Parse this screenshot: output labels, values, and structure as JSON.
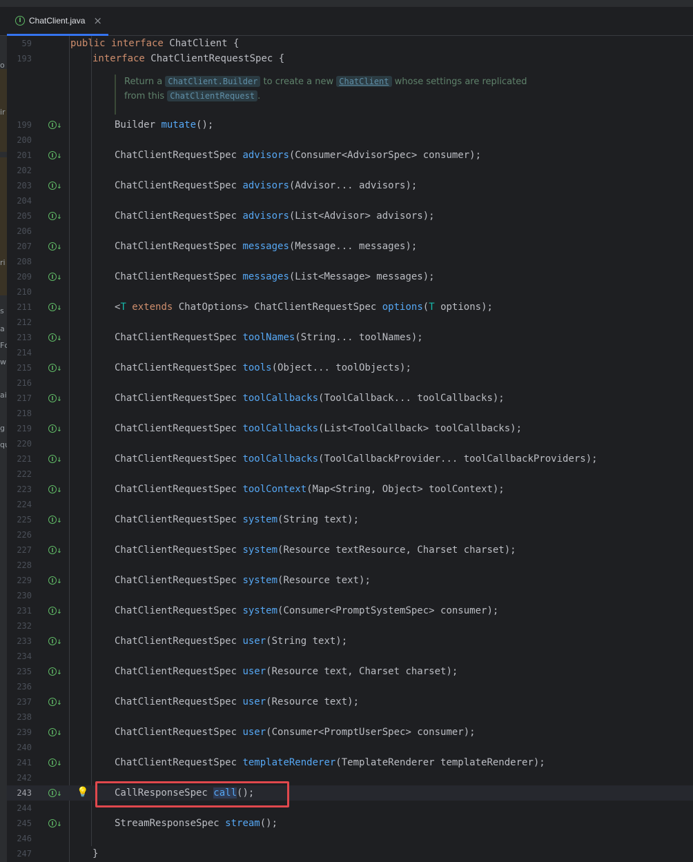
{
  "tab": {
    "label": "ChatClient.java",
    "icon": "interface-icon",
    "close": "×"
  },
  "sticky": [
    {
      "ln": "59",
      "parts": [
        [
          "kw",
          "public interface "
        ],
        [
          "",
          "ChatClient {"
        ]
      ]
    },
    {
      "ln": "193",
      "parts": [
        [
          "kw",
          "interface "
        ],
        [
          "",
          "ChatClientRequestSpec {"
        ]
      ]
    }
  ],
  "doc": {
    "line1_pre": "Return a ",
    "ref1": "ChatClient.Builder",
    "line1_mid": " to create a new ",
    "ref2": "ChatClient",
    "line1_post": " whose settings are replicated",
    "line2_pre": "from this ",
    "ref3": "ChatClientRequest",
    "line2_post": "."
  },
  "lines": [
    {
      "ln": "199",
      "impl": true,
      "parts": [
        [
          "",
          "Builder "
        ],
        [
          "fn",
          "mutate"
        ],
        [
          "",
          "();"
        ]
      ]
    },
    {
      "ln": "200"
    },
    {
      "ln": "201",
      "impl": true,
      "parts": [
        [
          "",
          "ChatClientRequestSpec "
        ],
        [
          "fn",
          "advisors"
        ],
        [
          "",
          "(Consumer<AdvisorSpec> consumer);"
        ]
      ]
    },
    {
      "ln": "202"
    },
    {
      "ln": "203",
      "impl": true,
      "parts": [
        [
          "",
          "ChatClientRequestSpec "
        ],
        [
          "fn",
          "advisors"
        ],
        [
          "",
          "(Advisor... advisors);"
        ]
      ]
    },
    {
      "ln": "204"
    },
    {
      "ln": "205",
      "impl": true,
      "parts": [
        [
          "",
          "ChatClientRequestSpec "
        ],
        [
          "fn",
          "advisors"
        ],
        [
          "",
          "(List<Advisor> advisors);"
        ]
      ]
    },
    {
      "ln": "206"
    },
    {
      "ln": "207",
      "impl": true,
      "parts": [
        [
          "",
          "ChatClientRequestSpec "
        ],
        [
          "fn",
          "messages"
        ],
        [
          "",
          "(Message... messages);"
        ]
      ]
    },
    {
      "ln": "208"
    },
    {
      "ln": "209",
      "impl": true,
      "parts": [
        [
          "",
          "ChatClientRequestSpec "
        ],
        [
          "fn",
          "messages"
        ],
        [
          "",
          "(List<Message> messages);"
        ]
      ]
    },
    {
      "ln": "210"
    },
    {
      "ln": "211",
      "impl": true,
      "parts": [
        [
          "",
          "<"
        ],
        [
          "tp",
          "T"
        ],
        [
          "kw",
          " extends "
        ],
        [
          "",
          "ChatOptions> ChatClientRequestSpec "
        ],
        [
          "fn",
          "options"
        ],
        [
          "",
          "("
        ],
        [
          "tp",
          "T"
        ],
        [
          "",
          " options);"
        ]
      ]
    },
    {
      "ln": "212"
    },
    {
      "ln": "213",
      "impl": true,
      "parts": [
        [
          "",
          "ChatClientRequestSpec "
        ],
        [
          "fn",
          "toolNames"
        ],
        [
          "",
          "(String... toolNames);"
        ]
      ]
    },
    {
      "ln": "214"
    },
    {
      "ln": "215",
      "impl": true,
      "parts": [
        [
          "",
          "ChatClientRequestSpec "
        ],
        [
          "fn",
          "tools"
        ],
        [
          "",
          "(Object... toolObjects);"
        ]
      ]
    },
    {
      "ln": "216"
    },
    {
      "ln": "217",
      "impl": true,
      "parts": [
        [
          "",
          "ChatClientRequestSpec "
        ],
        [
          "fn",
          "toolCallbacks"
        ],
        [
          "",
          "(ToolCallback... toolCallbacks);"
        ]
      ]
    },
    {
      "ln": "218"
    },
    {
      "ln": "219",
      "impl": true,
      "parts": [
        [
          "",
          "ChatClientRequestSpec "
        ],
        [
          "fn",
          "toolCallbacks"
        ],
        [
          "",
          "(List<ToolCallback> toolCallbacks);"
        ]
      ]
    },
    {
      "ln": "220"
    },
    {
      "ln": "221",
      "impl": true,
      "parts": [
        [
          "",
          "ChatClientRequestSpec "
        ],
        [
          "fn",
          "toolCallbacks"
        ],
        [
          "",
          "(ToolCallbackProvider... toolCallbackProviders);"
        ]
      ]
    },
    {
      "ln": "222"
    },
    {
      "ln": "223",
      "impl": true,
      "parts": [
        [
          "",
          "ChatClientRequestSpec "
        ],
        [
          "fn",
          "toolContext"
        ],
        [
          "",
          "(Map<String, Object> toolContext);"
        ]
      ]
    },
    {
      "ln": "224"
    },
    {
      "ln": "225",
      "impl": true,
      "parts": [
        [
          "",
          "ChatClientRequestSpec "
        ],
        [
          "fn",
          "system"
        ],
        [
          "",
          "(String text);"
        ]
      ]
    },
    {
      "ln": "226"
    },
    {
      "ln": "227",
      "impl": true,
      "parts": [
        [
          "",
          "ChatClientRequestSpec "
        ],
        [
          "fn",
          "system"
        ],
        [
          "",
          "(Resource textResource, Charset charset);"
        ]
      ]
    },
    {
      "ln": "228"
    },
    {
      "ln": "229",
      "impl": true,
      "parts": [
        [
          "",
          "ChatClientRequestSpec "
        ],
        [
          "fn",
          "system"
        ],
        [
          "",
          "(Resource text);"
        ]
      ]
    },
    {
      "ln": "230"
    },
    {
      "ln": "231",
      "impl": true,
      "parts": [
        [
          "",
          "ChatClientRequestSpec "
        ],
        [
          "fn",
          "system"
        ],
        [
          "",
          "(Consumer<PromptSystemSpec> consumer);"
        ]
      ]
    },
    {
      "ln": "232"
    },
    {
      "ln": "233",
      "impl": true,
      "parts": [
        [
          "",
          "ChatClientRequestSpec "
        ],
        [
          "fn",
          "user"
        ],
        [
          "",
          "(String text);"
        ]
      ]
    },
    {
      "ln": "234"
    },
    {
      "ln": "235",
      "impl": true,
      "parts": [
        [
          "",
          "ChatClientRequestSpec "
        ],
        [
          "fn",
          "user"
        ],
        [
          "",
          "(Resource text, Charset charset);"
        ]
      ]
    },
    {
      "ln": "236"
    },
    {
      "ln": "237",
      "impl": true,
      "parts": [
        [
          "",
          "ChatClientRequestSpec "
        ],
        [
          "fn",
          "user"
        ],
        [
          "",
          "(Resource text);"
        ]
      ]
    },
    {
      "ln": "238"
    },
    {
      "ln": "239",
      "impl": true,
      "parts": [
        [
          "",
          "ChatClientRequestSpec "
        ],
        [
          "fn",
          "user"
        ],
        [
          "",
          "(Consumer<PromptUserSpec> consumer);"
        ]
      ]
    },
    {
      "ln": "240"
    },
    {
      "ln": "241",
      "impl": true,
      "parts": [
        [
          "",
          "ChatClientRequestSpec "
        ],
        [
          "fn",
          "templateRenderer"
        ],
        [
          "",
          "(TemplateRenderer templateRenderer);"
        ]
      ]
    },
    {
      "ln": "242"
    },
    {
      "ln": "243",
      "impl": true,
      "current": true,
      "bulb": true,
      "parts": [
        [
          "",
          "CallResponseSpec "
        ],
        [
          "caret",
          ""
        ],
        [
          "fn-sel",
          "call"
        ],
        [
          "",
          "();"
        ]
      ]
    },
    {
      "ln": "244"
    },
    {
      "ln": "245",
      "impl": true,
      "parts": [
        [
          "",
          "StreamResponseSpec "
        ],
        [
          "fn",
          "stream"
        ],
        [
          "",
          "();"
        ]
      ]
    },
    {
      "ln": "246"
    },
    {
      "ln": "247",
      "close": true,
      "parts": [
        [
          "",
          "}"
        ]
      ]
    }
  ],
  "left_fragments": [
    "o",
    "ir",
    "ri",
    "s",
    "a",
    "Fc",
    "w",
    "ai",
    "g",
    "qu"
  ],
  "colors": {
    "keyword": "#cf8e6d",
    "method": "#56a8f5",
    "type_param": "#16baac",
    "text": "#bcbec4",
    "highlight_box": "#e0484d"
  }
}
